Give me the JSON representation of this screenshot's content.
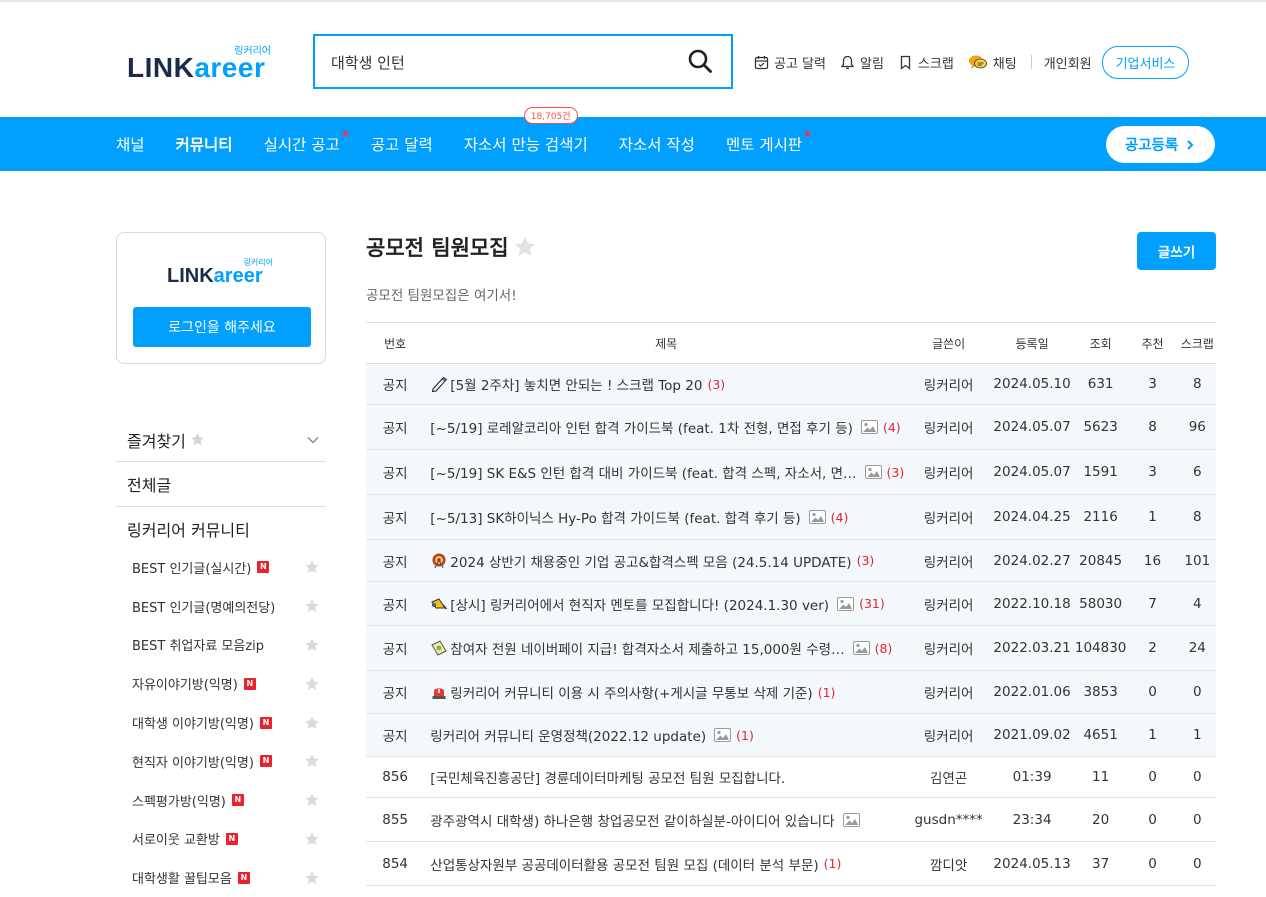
{
  "brand": {
    "name_dark": "LINK",
    "name_accent": "areer",
    "sub": "링커리어"
  },
  "search": {
    "value": "대학생 인턴"
  },
  "header_nav": {
    "calendar": "공고 달력",
    "alarm": "알림",
    "scrap": "스크랩",
    "chat": "채팅",
    "member": "개인회원",
    "business": "기업서비스"
  },
  "main_menu": {
    "items": [
      "채널",
      "커뮤니티",
      "실시간 공고",
      "공고 달력",
      "자소서 만능 검색기",
      "자소서 작성",
      "멘토 게시판"
    ],
    "badge": "18,705건",
    "register": "공고등록"
  },
  "sidebar": {
    "login_button": "로그인을 해주세요",
    "favorites": "즐겨찾기",
    "all_posts": "전체글",
    "community_title": "링커리어 커뮤니티",
    "badge_new": "N",
    "items": [
      {
        "label": "BEST 인기글(실시간)",
        "new": true
      },
      {
        "label": "BEST 인기글(명예의전당)",
        "new": false
      },
      {
        "label": "BEST 취업자료 모음zip",
        "new": false
      },
      {
        "label": "자유이야기방(익명)",
        "new": true
      },
      {
        "label": "대학생 이야기방(익명)",
        "new": true
      },
      {
        "label": "현직자 이야기방(익명)",
        "new": true
      },
      {
        "label": "스펙평가방(익명)",
        "new": true
      },
      {
        "label": "서로이웃 교환방",
        "new": true
      },
      {
        "label": "대학생활 꿀팁모음",
        "new": true
      }
    ]
  },
  "board": {
    "title": "공모전 팀원모집",
    "description": "공모전 팀원모집은 여기서!",
    "write_button": "글쓰기",
    "columns": [
      "번호",
      "제목",
      "글쓴이",
      "등록일",
      "조회",
      "추천",
      "스크랩"
    ],
    "rows": [
      {
        "no": "공지",
        "emoji": "pen",
        "title": "[5월 2주차] 놓치면 안되는 ! 스크랩 Top 20",
        "img": false,
        "comments": "(3)",
        "author": "링커리어",
        "date": "2024.05.10",
        "views": "631",
        "likes": "3",
        "scraps": "8",
        "notice": true
      },
      {
        "no": "공지",
        "emoji": "",
        "title": "[~5/19] 로레알코리아 인턴 합격 가이드북 (feat. 1차 전형, 면접 후기 등)",
        "img": true,
        "comments": "(4)",
        "author": "링커리어",
        "date": "2024.05.07",
        "views": "5623",
        "likes": "8",
        "scraps": "96",
        "notice": true
      },
      {
        "no": "공지",
        "emoji": "",
        "title": "[~5/19] SK E&S 인턴 합격 대비 가이드북 (feat. 합격 스펙, 자소서, 면…",
        "img": true,
        "comments": "(3)",
        "author": "링커리어",
        "date": "2024.05.07",
        "views": "1591",
        "likes": "3",
        "scraps": "6",
        "notice": true
      },
      {
        "no": "공지",
        "emoji": "",
        "title": "[~5/13] SK하이닉스 Hy-Po 합격 가이드북 (feat. 합격 후기 등)",
        "img": true,
        "comments": "(4)",
        "author": "링커리어",
        "date": "2024.04.25",
        "views": "2116",
        "likes": "1",
        "scraps": "8",
        "notice": true
      },
      {
        "no": "공지",
        "emoji": "wheel",
        "title": "2024 상반기 채용중인 기업 공고&합격스펙 모음 (24.5.14 UPDATE)",
        "img": false,
        "comments": "(3)",
        "author": "링커리어",
        "date": "2024.02.27",
        "views": "20845",
        "likes": "16",
        "scraps": "101",
        "notice": true
      },
      {
        "no": "공지",
        "emoji": "horn",
        "title": "[상시] 링커리어에서 현직자 멘토를 모집합니다! (2024.1.30 ver)",
        "img": true,
        "comments": "(31)",
        "author": "링커리어",
        "date": "2022.10.18",
        "views": "58030",
        "likes": "7",
        "scraps": "4",
        "notice": true
      },
      {
        "no": "공지",
        "emoji": "coin",
        "title": "참여자 전원 네이버페이 지급! 합격자소서 제출하고 15,000원 수령…",
        "img": true,
        "comments": "(8)",
        "author": "링커리어",
        "date": "2022.03.21",
        "views": "104830",
        "likes": "2",
        "scraps": "24",
        "notice": true
      },
      {
        "no": "공지",
        "emoji": "siren",
        "title": "링커리어 커뮤니티 이용 시 주의사항(+게시글 무통보 삭제 기준)",
        "img": false,
        "comments": "(1)",
        "author": "링커리어",
        "date": "2022.01.06",
        "views": "3853",
        "likes": "0",
        "scraps": "0",
        "notice": true
      },
      {
        "no": "공지",
        "emoji": "",
        "title": "링커리어 커뮤니티 운영정책(2022.12 update)",
        "img": true,
        "comments": "(1)",
        "author": "링커리어",
        "date": "2021.09.02",
        "views": "4651",
        "likes": "1",
        "scraps": "1",
        "notice": true
      },
      {
        "no": "856",
        "emoji": "",
        "title": "[국민체육진흥공단] 경륜데이터마케팅 공모전 팀원 모집합니다.",
        "img": false,
        "comments": "",
        "author": "김연곤",
        "date": "01:39",
        "views": "11",
        "likes": "0",
        "scraps": "0",
        "notice": false
      },
      {
        "no": "855",
        "emoji": "",
        "title": "광주광역시 대학생) 하나은행 창업공모전 같이하실분-아이디어 있습니다",
        "img": true,
        "comments": "",
        "author": "gusdn****",
        "date": "23:34",
        "views": "20",
        "likes": "0",
        "scraps": "0",
        "notice": false
      },
      {
        "no": "854",
        "emoji": "",
        "title": "산업통상자원부 공공데이터활용 공모전 팀원 모집 (데이터 분석 부문)",
        "img": false,
        "comments": "(1)",
        "author": "깜디앗",
        "date": "2024.05.13",
        "views": "37",
        "likes": "0",
        "scraps": "0",
        "notice": false
      }
    ]
  },
  "colors": {
    "accent": "#01a0ff",
    "new_badge": "#e8232e",
    "notice_bg": "#f2f8fc",
    "brand_dark": "#1b2a4a"
  }
}
